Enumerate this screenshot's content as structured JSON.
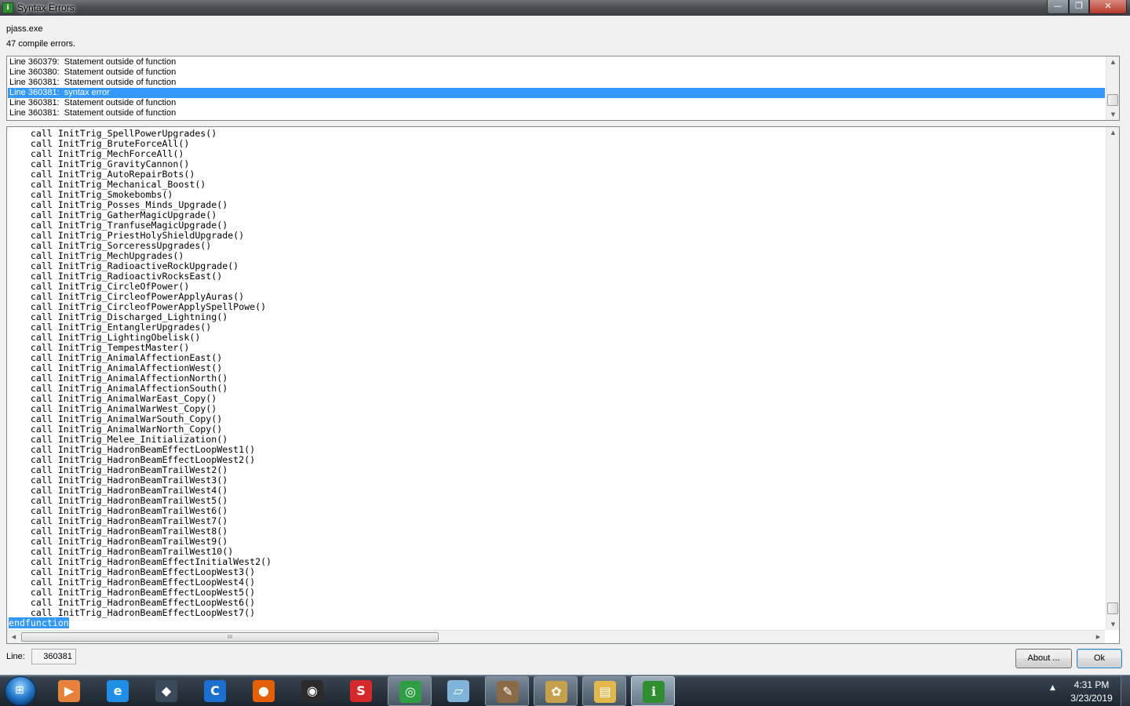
{
  "window": {
    "title": "Syntax Errors",
    "icon_label": "ℹ︎",
    "minimize_glyph": "—",
    "maximize_glyph": "❐",
    "close_glyph": "✕"
  },
  "header": {
    "exe_name": "pjass.exe",
    "error_count": "47 compile errors."
  },
  "errors": [
    "Line 360379:  Statement outside of function",
    "Line 360380:  Statement outside of function",
    "Line 360381:  Statement outside of function",
    "Line 360381:  syntax error",
    "Line 360381:  Statement outside of function",
    "Line 360381:  Statement outside of function"
  ],
  "selected_error_index": 3,
  "code": [
    "    call InitTrig_SpellPowerUpgrades()",
    "    call InitTrig_BruteForceAll()",
    "    call InitTrig_MechForceAll()",
    "    call InitTrig_GravityCannon()",
    "    call InitTrig_AutoRepairBots()",
    "    call InitTrig_Mechanical_Boost()",
    "    call InitTrig_Smokebombs()",
    "    call InitTrig_Posses_Minds_Upgrade()",
    "    call InitTrig_GatherMagicUpgrade()",
    "    call InitTrig_TranfuseMagicUpgrade()",
    "    call InitTrig_PriestHolyShieldUpgrade()",
    "    call InitTrig_SorceressUpgrades()",
    "    call InitTrig_MechUpgrades()",
    "    call InitTrig_RadioactiveRockUpgrade()",
    "    call InitTrig_RadioactivRocksEast()",
    "    call InitTrig_CircleOfPower()",
    "    call InitTrig_CircleofPowerApplyAuras()",
    "    call InitTrig_CircleofPowerApplySpellPowe()",
    "    call InitTrig_Discharged_Lightning()",
    "    call InitTrig_EntanglerUpgrades()",
    "    call InitTrig_LightingObelisk()",
    "    call InitTrig_TempestMaster()",
    "    call InitTrig_AnimalAffectionEast()",
    "    call InitTrig_AnimalAffectionWest()",
    "    call InitTrig_AnimalAffectionNorth()",
    "    call InitTrig_AnimalAffectionSouth()",
    "    call InitTrig_AnimalWarEast_Copy()",
    "    call InitTrig_AnimalWarWest_Copy()",
    "    call InitTrig_AnimalWarSouth_Copy()",
    "    call InitTrig_AnimalWarNorth_Copy()",
    "    call InitTrig_Melee_Initialization()",
    "    call InitTrig_HadronBeamEffectLoopWest1()",
    "    call InitTrig_HadronBeamEffectLoopWest2()",
    "    call InitTrig_HadronBeamTrailWest2()",
    "    call InitTrig_HadronBeamTrailWest3()",
    "    call InitTrig_HadronBeamTrailWest4()",
    "    call InitTrig_HadronBeamTrailWest5()",
    "    call InitTrig_HadronBeamTrailWest6()",
    "    call InitTrig_HadronBeamTrailWest7()",
    "    call InitTrig_HadronBeamTrailWest8()",
    "    call InitTrig_HadronBeamTrailWest9()",
    "    call InitTrig_HadronBeamTrailWest10()",
    "    call InitTrig_HadronBeamEffectInitialWest2()",
    "    call InitTrig_HadronBeamEffectLoopWest3()",
    "    call InitTrig_HadronBeamEffectLoopWest4()",
    "    call InitTrig_HadronBeamEffectLoopWest5()",
    "    call InitTrig_HadronBeamEffectLoopWest6()",
    "    call InitTrig_HadronBeamEffectLoopWest7()"
  ],
  "selected_code": "endfunction",
  "footer": {
    "line_label": "Line:",
    "line_value": "360381",
    "about_button": "About ...",
    "ok_button": "Ok"
  },
  "scroll_glyphs": {
    "up": "▲",
    "down": "▼",
    "left": "◀",
    "right": "▶",
    "grip": "III"
  },
  "taskbar": {
    "start_glyph": "⊞",
    "tray_arrow": "▲",
    "time": "4:31 PM",
    "date": "3/23/2019",
    "apps": [
      {
        "name": "media-player-icon",
        "glyph": "▶",
        "color": "#e8823a",
        "state": "none"
      },
      {
        "name": "internet-explorer-icon",
        "glyph": "e",
        "color": "#1f8ee6",
        "state": "none"
      },
      {
        "name": "app-launcher-icon",
        "glyph": "◆",
        "color": "#3a4a5a",
        "state": "none"
      },
      {
        "name": "ccleaner-icon",
        "glyph": "C",
        "color": "#1b6fd1",
        "state": "none"
      },
      {
        "name": "firefox-icon",
        "glyph": "●",
        "color": "#e66000",
        "state": "none"
      },
      {
        "name": "obs-icon",
        "glyph": "◉",
        "color": "#2b2b2b",
        "state": "none"
      },
      {
        "name": "wps-icon",
        "glyph": "S",
        "color": "#d4282a",
        "state": "none"
      },
      {
        "name": "chrome-icon",
        "glyph": "◎",
        "color": "#2e9e45",
        "state": "open"
      },
      {
        "name": "notepad-icon",
        "glyph": "▱",
        "color": "#7fb3d9",
        "state": "none"
      },
      {
        "name": "world-editor-icon",
        "glyph": "✎",
        "color": "#8a6b45",
        "state": "open"
      },
      {
        "name": "paint-icon",
        "glyph": "✿",
        "color": "#c7a04a",
        "state": "open"
      },
      {
        "name": "explorer-folder-icon",
        "glyph": "▤",
        "color": "#e2b84a",
        "state": "open"
      },
      {
        "name": "syntax-checker-icon",
        "glyph": "ℹ︎",
        "color": "#2f8f2f",
        "state": "active"
      }
    ]
  }
}
